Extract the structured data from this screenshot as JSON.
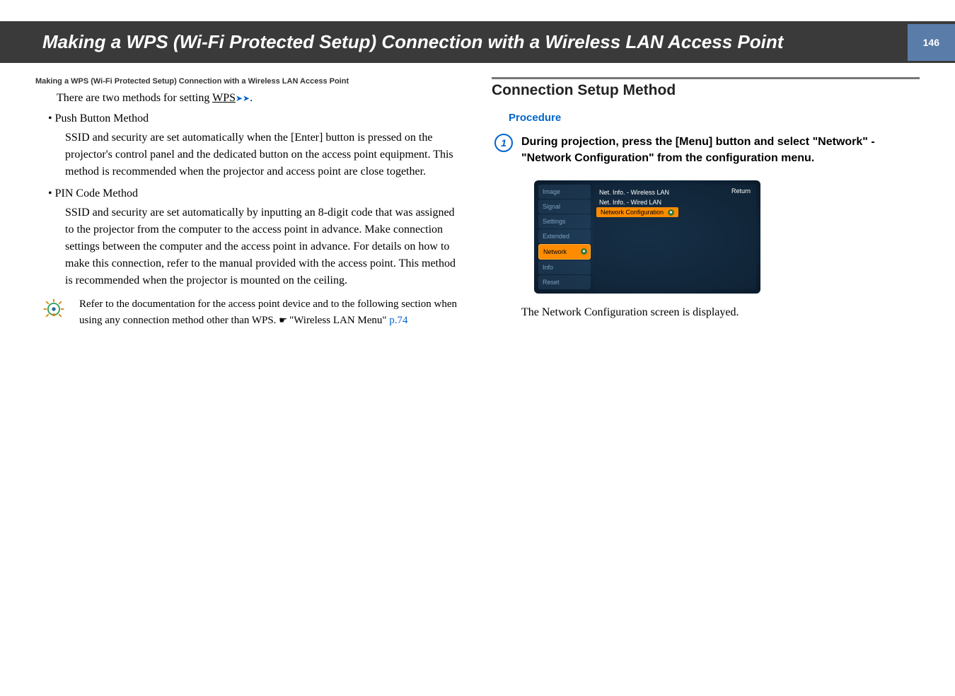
{
  "header": {
    "title": "Making a WPS (Wi-Fi Protected Setup) Connection with a Wireless LAN Access Point",
    "page_number": "146"
  },
  "left": {
    "breadcrumb": "Making a WPS (Wi-Fi Protected Setup) Connection with a Wireless LAN Access Point",
    "intro_prefix": "There are two methods for setting ",
    "wps_link": "WPS",
    "intro_suffix": ".",
    "method1_title": "Push Button Method",
    "method1_desc": "SSID and security are set automatically when the [Enter] button is pressed on the projector's control panel and the dedicated button on the access point equipment. This method is recommended when the projector and access point are close together.",
    "method2_title": "PIN Code Method",
    "method2_desc": "SSID and security are set automatically by inputting an 8-digit code that was assigned to the projector from the computer to the access point in advance. Make connection settings between the computer and the access point in advance. For details on how to make this connection, refer to the manual provided with the access point. This method is recommended when the projector is mounted on the ceiling.",
    "tip_text_pre": "Refer to the documentation for the access point device and to the following section when using any connection method other than WPS. ",
    "tip_ref": "\"Wireless LAN Menu\"",
    "tip_page": " p.74"
  },
  "right": {
    "section_title": "Connection Setup Method",
    "procedure_label": "Procedure",
    "step_number": "1",
    "step_text": "During projection, press the [Menu] button and select \"Network\" - \"Network Configuration\" from the configuration menu.",
    "menu": {
      "return": "Return",
      "items": [
        "Image",
        "Signal",
        "Settings",
        "Extended",
        "Network",
        "Info",
        "Reset"
      ],
      "lines": [
        "Net. Info. - Wireless LAN",
        "Net. Info. - Wired LAN",
        "Network Configuration"
      ]
    },
    "result": "The Network Configuration screen is displayed."
  }
}
